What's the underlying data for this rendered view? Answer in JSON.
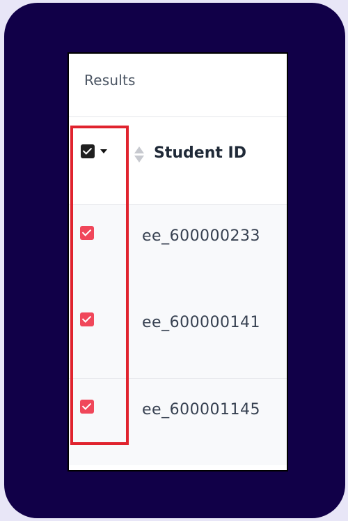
{
  "panel": {
    "title": "Results"
  },
  "table": {
    "columns": [
      {
        "label": "Student ID",
        "sortable": true
      }
    ],
    "select_all_checked": true,
    "rows": [
      {
        "student_id": "ee_600000233",
        "selected": true
      },
      {
        "student_id": "ee_600000141",
        "selected": true
      },
      {
        "student_id": "ee_600001145",
        "selected": true
      }
    ]
  },
  "colors": {
    "frame": "#110048",
    "checkbox_selected": "#f0475a",
    "highlight": "#e0232e"
  },
  "icons": {
    "master_checkbox": "checkbox-checked-icon",
    "caret": "caret-down-icon",
    "sort": "sort-icon"
  }
}
